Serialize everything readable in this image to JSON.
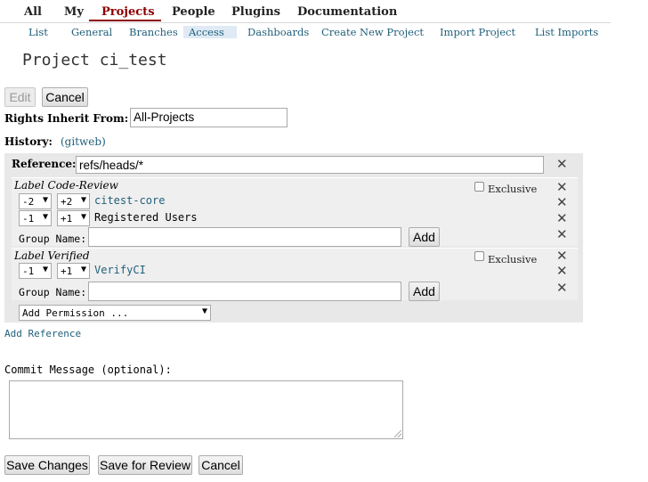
{
  "top_menu": [
    "All",
    "My",
    "Projects",
    "People",
    "Plugins",
    "Documentation"
  ],
  "sub_menu": [
    "List",
    "General",
    "Branches",
    "Access",
    "Dashboards",
    "Create New Project",
    "Import Project",
    "List Imports"
  ],
  "page_title": "Project ci_test",
  "edit_label": "Edit",
  "cancel_label": "Cancel",
  "rights_inherit_label": "Rights Inherit From:",
  "rights_inherit_value": "All-Projects",
  "history_label": "History:",
  "history_link": "(gitweb)",
  "reference_label": "Reference:",
  "reference_value": "refs/heads/*",
  "label_code_review": {
    "title": "Label Code-Review",
    "exclusive": "Exclusive",
    "rules": [
      {
        "min": "-2",
        "max": "+2",
        "group": "citest-core"
      },
      {
        "min": "-1",
        "max": "+1",
        "group": "Registered Users"
      }
    ],
    "group_name_label": "Group Name:",
    "add_label": "Add"
  },
  "label_verified": {
    "title": "Label Verified",
    "exclusive": "Exclusive",
    "rules": [
      {
        "min": "-1",
        "max": "+1",
        "group": "VerifyCI"
      }
    ],
    "group_name_label": "Group Name:",
    "add_label": "Add"
  },
  "add_permission": "Add Permission ...",
  "add_reference": "Add Reference",
  "commit_message_label": "Commit Message (optional):",
  "save_changes": "Save Changes",
  "save_for_review": "Save for Review",
  "cancel_bottom": "Cancel",
  "colors": {
    "accent": "#8b0000",
    "link": "#1f5f7a",
    "panel": "#e8e8e8"
  }
}
